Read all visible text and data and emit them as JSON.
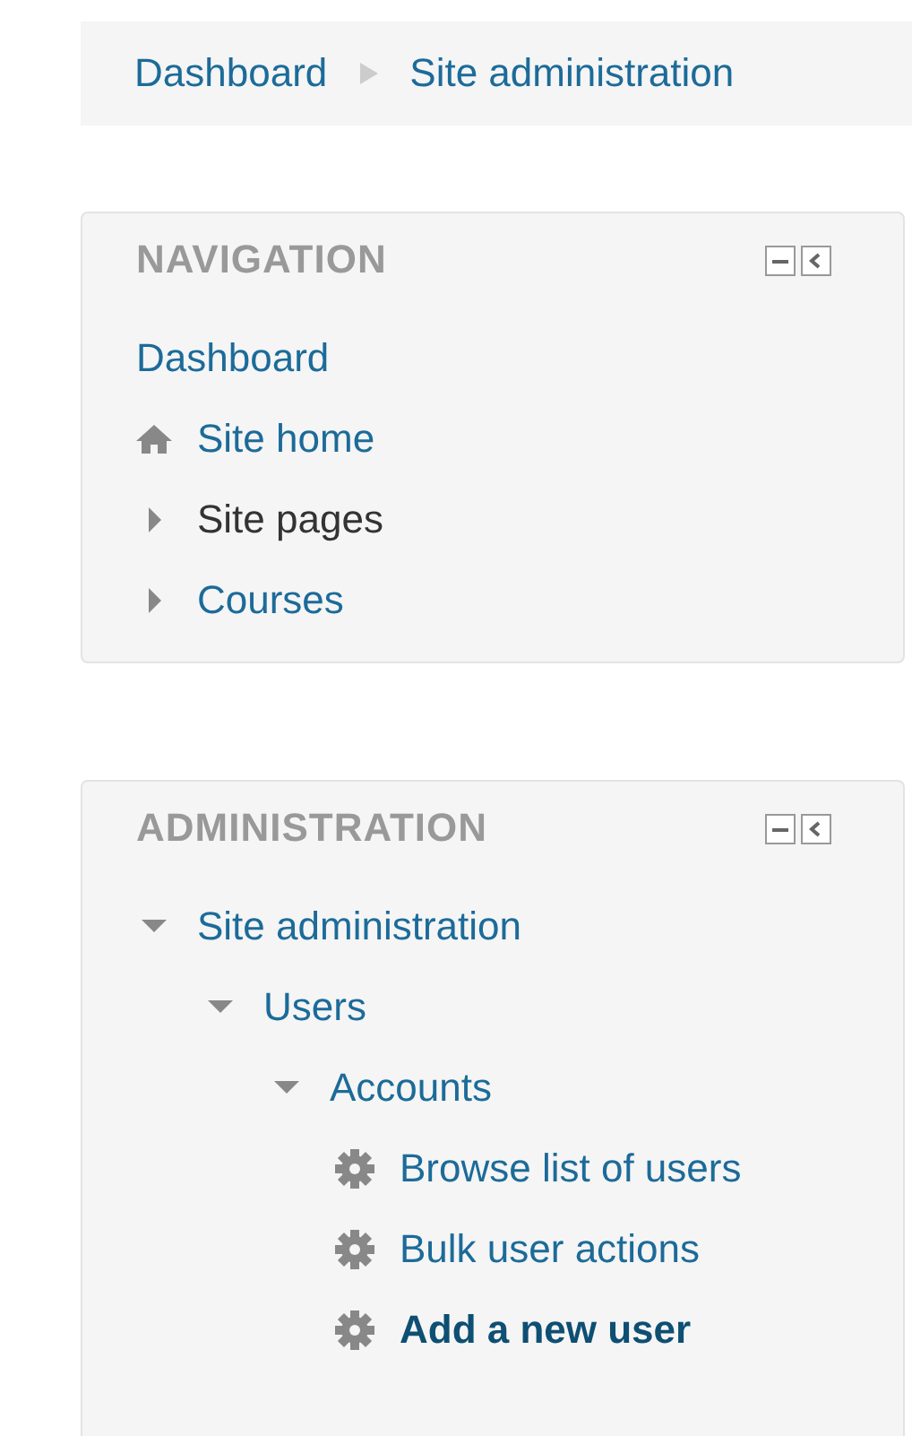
{
  "breadcrumb": [
    "Dashboard",
    "Site administration"
  ],
  "blocks": [
    {
      "title": "NAVIGATION",
      "items": [
        {
          "label": "Dashboard",
          "kind": "link",
          "link": true,
          "active": false
        },
        {
          "label": "Site home",
          "kind": "home",
          "link": true,
          "active": false
        },
        {
          "label": "Site pages",
          "kind": "branch",
          "expanded": false,
          "link": false,
          "active": false
        },
        {
          "label": "Courses",
          "kind": "branch",
          "expanded": false,
          "link": true,
          "active": false
        }
      ]
    },
    {
      "title": "ADMINISTRATION",
      "items": [
        {
          "label": "Site administration",
          "kind": "branch",
          "expanded": true,
          "link": true,
          "active": false,
          "children": [
            {
              "label": "Users",
              "kind": "branch",
              "expanded": true,
              "link": true,
              "active": false,
              "children": [
                {
                  "label": "Accounts",
                  "kind": "branch",
                  "expanded": true,
                  "link": true,
                  "active": false,
                  "children": [
                    {
                      "label": "Browse list of users",
                      "kind": "setting",
                      "link": true,
                      "active": false
                    },
                    {
                      "label": "Bulk user actions",
                      "kind": "setting",
                      "link": true,
                      "active": false
                    },
                    {
                      "label": "Add a new user",
                      "kind": "setting",
                      "link": true,
                      "active": true
                    }
                  ]
                }
              ]
            }
          ]
        }
      ]
    }
  ]
}
